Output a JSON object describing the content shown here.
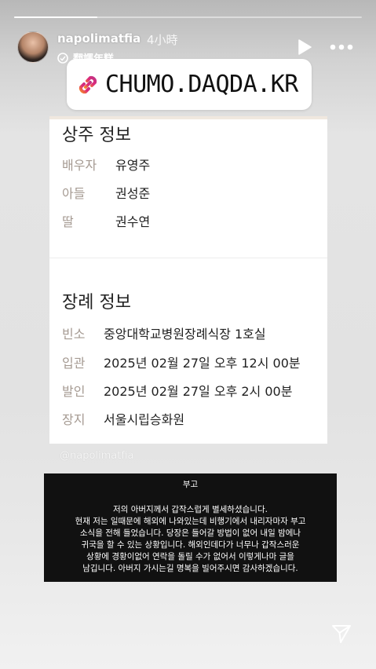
{
  "story": {
    "progress": 0.24
  },
  "header": {
    "username": "napolimatfia",
    "time": "4小時",
    "translate_label": "翻譯年糕"
  },
  "sticker": {
    "text": "CHUMO.DAQDA.KR"
  },
  "card": {
    "mourner_title": "상주 정보",
    "mourners": [
      {
        "label": "배우자",
        "value": "유영주"
      },
      {
        "label": "아들",
        "value": "권성준"
      },
      {
        "label": "딸",
        "value": "권수연"
      }
    ],
    "funeral_title": "장례 정보",
    "funeral": [
      {
        "label": "빈소",
        "value": "중앙대학교병원장례식장 1호실"
      },
      {
        "label": "입관",
        "value": "2025년 02월 27일 오후 12시 00분"
      },
      {
        "label": "발인",
        "value": "2025년 02월 27일 오후 2시 00분"
      },
      {
        "label": "장지",
        "value": "서울시립승화원"
      }
    ]
  },
  "watermark": "@napolimatfia",
  "notice": {
    "title": "부고",
    "lines": [
      "저의 아버지께서 갑작스럽게 별세하셨습니다.",
      "현재 저는 일때문에 해외에 나와있는데 비행기에서 내리자마자 부고",
      "소식을 전해 들었습니다. 당장은 들어갈 방법이 없어 내일 밤에나",
      "귀국을 할 수 있는 상황입니다. 해외인데다가 너무나 갑작스러운",
      "상황에 경황이없어 연락을 돌릴 수가 없어서 이렇게나마 글을",
      "남깁니다. 아버지 가시는길 명복을 빌어주시면 감사하겠습니다."
    ]
  },
  "colors": {
    "sticker_icon_start": "#f58529",
    "sticker_icon_end": "#c13584",
    "label_gray": "#a59a92"
  },
  "icons": [
    "play-icon",
    "more-icon",
    "translate-icon",
    "link-icon",
    "send-icon"
  ]
}
